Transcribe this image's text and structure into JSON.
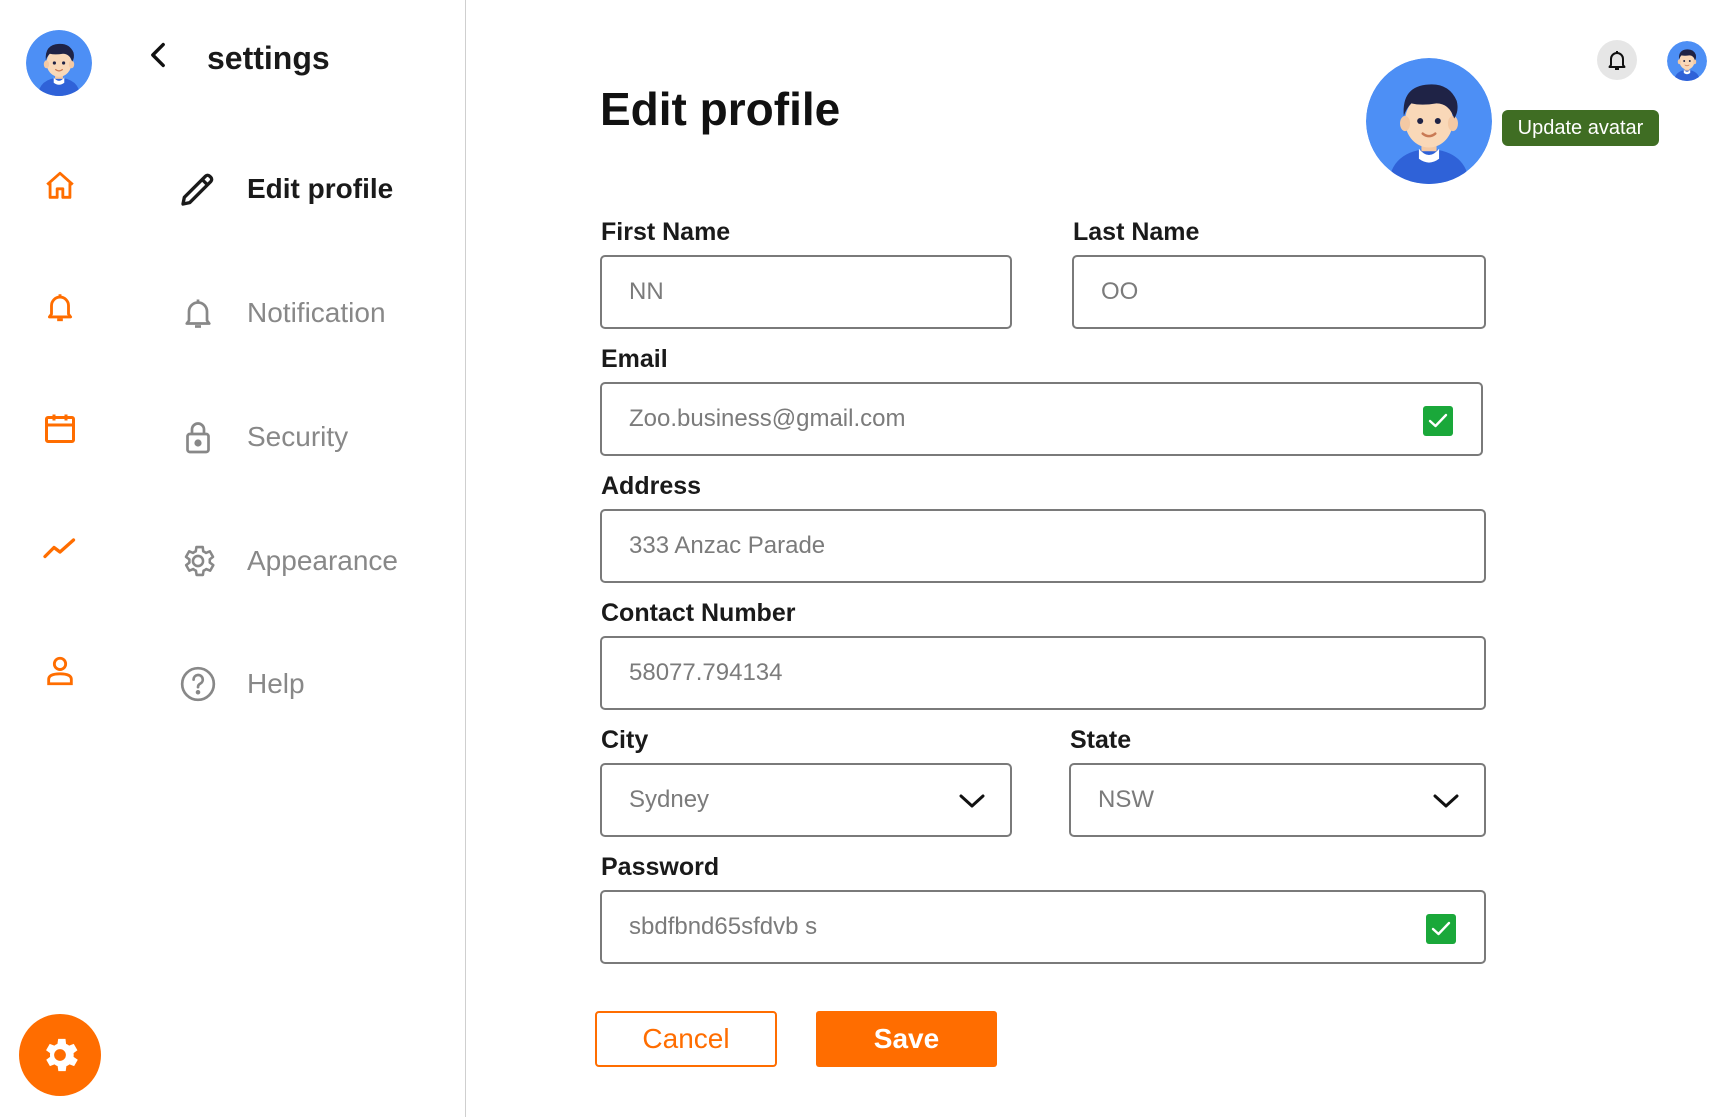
{
  "colors": {
    "accent": "#ff6d00",
    "avatar_bg": "#4d8ff5",
    "success": "#1aa83a",
    "tooltip_bg": "#3f6d23"
  },
  "rail": {
    "avatar_icon": "user-avatar",
    "items": [
      {
        "icon": "home-icon"
      },
      {
        "icon": "bell-icon"
      },
      {
        "icon": "calendar-icon"
      },
      {
        "icon": "trend-icon"
      },
      {
        "icon": "user-icon"
      }
    ],
    "settings_icon": "gear-icon"
  },
  "settings_menu": {
    "title": "settings",
    "back_icon": "chevron-left-icon",
    "items": [
      {
        "label": "Edit profile",
        "icon": "pencil-icon",
        "active": true
      },
      {
        "label": "Notification",
        "icon": "bell-icon",
        "active": false
      },
      {
        "label": "Security",
        "icon": "lock-icon",
        "active": false
      },
      {
        "label": "Appearance",
        "icon": "gear-icon",
        "active": false
      },
      {
        "label": "Help",
        "icon": "help-circle-icon",
        "active": false
      }
    ]
  },
  "header": {
    "title": "Edit profile",
    "update_avatar_label": "Update avatar"
  },
  "form": {
    "first_name": {
      "label": "First Name",
      "value": "NN"
    },
    "last_name": {
      "label": "Last Name",
      "value": "OO"
    },
    "email": {
      "label": "Email",
      "value": "Zoo.business@gmail.com",
      "verified": true
    },
    "address": {
      "label": "Address",
      "value": "333 Anzac Parade"
    },
    "contact": {
      "label": "Contact Number",
      "value": "58077.794134"
    },
    "city": {
      "label": "City",
      "value": "Sydney"
    },
    "state": {
      "label": "State",
      "value": "NSW"
    },
    "password": {
      "label": "Password",
      "value": "sbdfbnd65sfdvb s",
      "verified": true
    }
  },
  "actions": {
    "cancel_label": "Cancel",
    "save_label": "Save"
  }
}
